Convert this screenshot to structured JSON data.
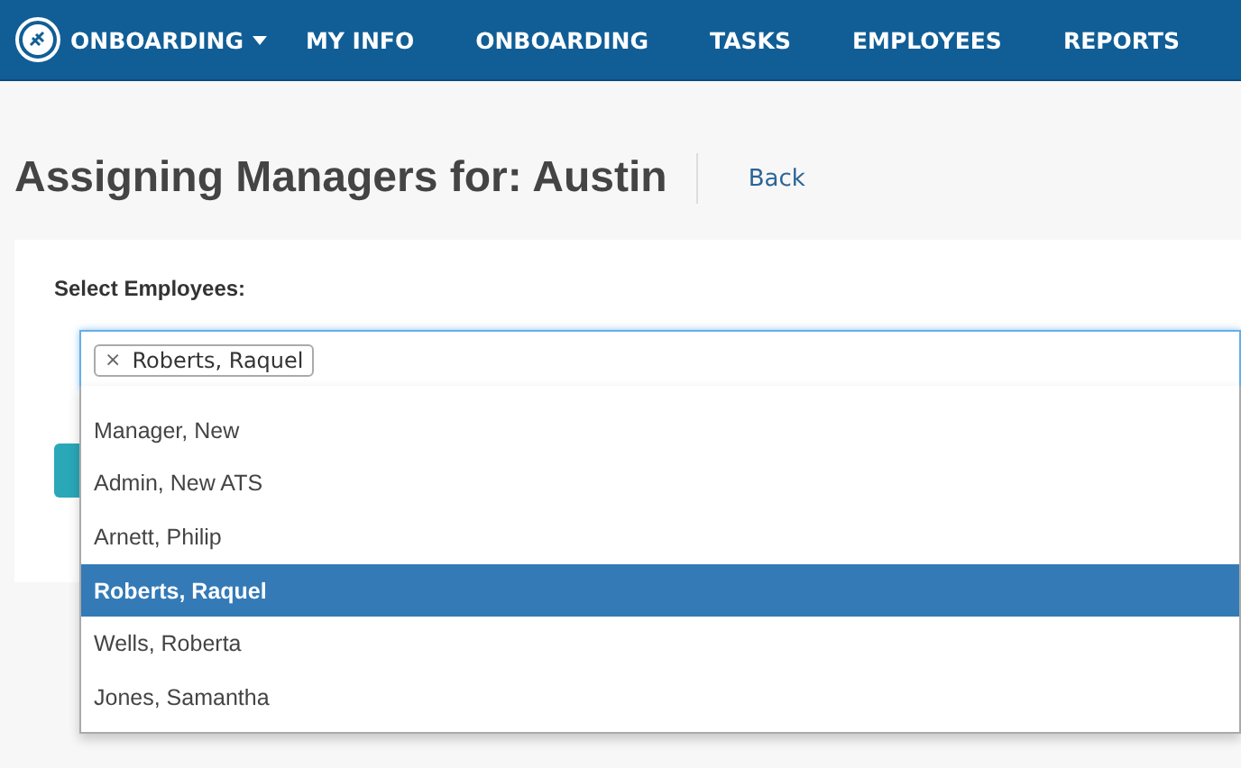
{
  "nav": {
    "brand": "ONBOARDING",
    "items": [
      {
        "label": "MY INFO"
      },
      {
        "label": "ONBOARDING"
      },
      {
        "label": "TASKS"
      },
      {
        "label": "EMPLOYEES"
      },
      {
        "label": "REPORTS"
      }
    ]
  },
  "title": "Assigning Managers for: Austin",
  "back_link": "Back",
  "form": {
    "label": "Select Employees:",
    "tags": [
      {
        "label": "Roberts, Raquel",
        "remove": "×"
      }
    ],
    "options": [
      {
        "label": "Manager, New",
        "selected": false
      },
      {
        "label": "Admin, New ATS",
        "selected": false
      },
      {
        "label": "Arnett, Philip",
        "selected": false
      },
      {
        "label": "Roberts, Raquel",
        "selected": true
      },
      {
        "label": "Wells, Roberta",
        "selected": false
      },
      {
        "label": "Jones, Samantha",
        "selected": false
      }
    ]
  }
}
